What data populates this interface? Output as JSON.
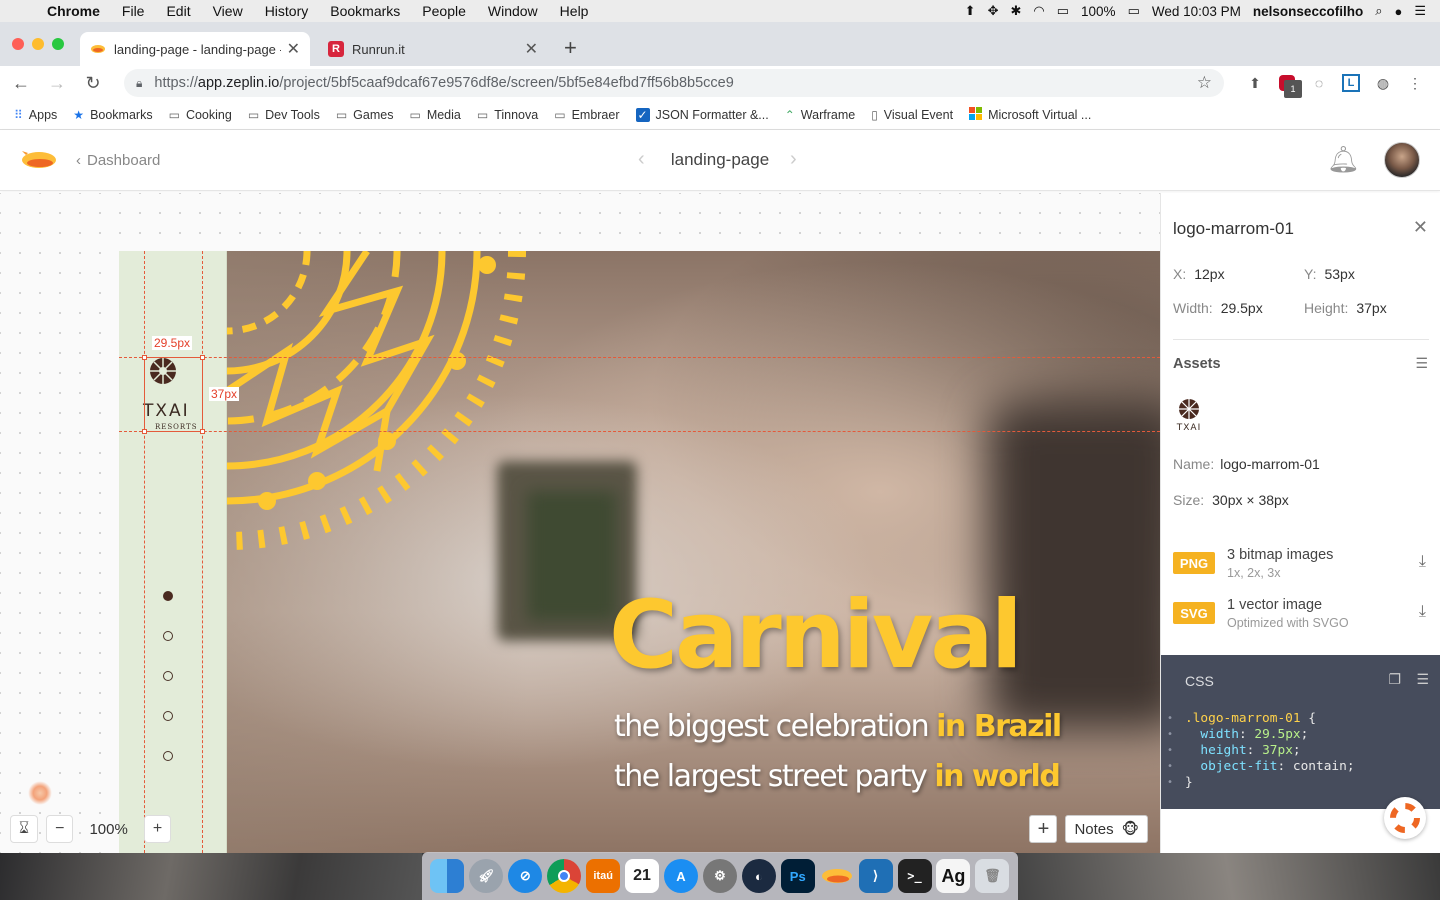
{
  "menubar": {
    "app": "Chrome",
    "items": [
      "File",
      "Edit",
      "View",
      "History",
      "Bookmarks",
      "People",
      "Window",
      "Help"
    ],
    "battery": "100%",
    "clock": "Wed 10:03 PM",
    "user": "nelsonseccofilho"
  },
  "tabs": [
    {
      "title": "landing-page - landing-page - ",
      "icon": "zeplin-favicon"
    },
    {
      "title": "Runrun.it",
      "icon": "runrun-favicon"
    }
  ],
  "address": {
    "scheme": "https://",
    "host": "app.zeplin.io",
    "path": "/project/5bf5caaf9dcaf67e9576df8e/screen/5bf5e84efbd7ff56b8b5cce9"
  },
  "extensions": {
    "abp_badge": "1"
  },
  "bookmarks": [
    {
      "label": "Apps",
      "icon": "apps-grid-icon"
    },
    {
      "label": "Bookmarks",
      "icon": "star-icon"
    },
    {
      "label": "Cooking",
      "icon": "folder-icon"
    },
    {
      "label": "Dev Tools",
      "icon": "folder-icon"
    },
    {
      "label": "Games",
      "icon": "folder-icon"
    },
    {
      "label": "Media",
      "icon": "folder-icon"
    },
    {
      "label": "Tinnova",
      "icon": "folder-icon"
    },
    {
      "label": "Embraer",
      "icon": "folder-icon"
    },
    {
      "label": "JSON Formatter &...",
      "icon": "checkbox-icon"
    },
    {
      "label": "Warframe",
      "icon": "warframe-icon"
    },
    {
      "label": "Visual Event",
      "icon": "page-icon"
    },
    {
      "label": "Microsoft Virtual ...",
      "icon": "microsoft-icon"
    }
  ],
  "zeplin": {
    "back_label": "Dashboard",
    "screen_title": "landing-page",
    "zoom": "100%",
    "notes_label": "Notes"
  },
  "artboard": {
    "headline": "Carnival",
    "line1_plain": "the biggest celebration ",
    "line1_bold": "in Brazil",
    "line2_plain": "the largest street party ",
    "line2_bold": "in world",
    "logo_text": "TXAI",
    "logo_sub": "RESORTS",
    "width_label": "29.5px",
    "height_label": "37px"
  },
  "panel": {
    "layer_name": "logo-marrom-01",
    "x_label": "X:",
    "x_value": "12px",
    "y_label": "Y:",
    "y_value": "53px",
    "w_label": "Width:",
    "w_value": "29.5px",
    "h_label": "Height:",
    "h_value": "37px",
    "assets_label": "Assets",
    "name_label": "Name:",
    "name_value": "logo-marrom-01",
    "size_label": "Size:",
    "size_value": "30px × 38px",
    "png": {
      "tag": "PNG",
      "title": "3 bitmap images",
      "sub": "1x, 2x, 3x"
    },
    "svg": {
      "tag": "SVG",
      "title": "1 vector image",
      "sub": "Optimized with SVGO"
    },
    "css_label": "CSS",
    "css": {
      "selector": ".logo-marrom-01",
      "width_prop": "width",
      "width_val": "29.5px",
      "height_prop": "height",
      "height_val": "37px",
      "fit_prop": "object-fit",
      "fit_val": "contain"
    }
  },
  "colors": {
    "accent_yellow": "#fdc82f",
    "measure_red": "#e45a3a",
    "css_panel_bg": "#464c5c",
    "asset_tag": "#f5b221"
  },
  "dock": [
    {
      "name": "finder-icon"
    },
    {
      "name": "launchpad-icon"
    },
    {
      "name": "safari-icon"
    },
    {
      "name": "chrome-icon"
    },
    {
      "name": "itau-icon",
      "label": "itaú"
    },
    {
      "name": "calendar-icon",
      "label": "21"
    },
    {
      "name": "app-store-icon"
    },
    {
      "name": "system-preferences-icon"
    },
    {
      "name": "sourcetree-icon"
    },
    {
      "name": "photoshop-icon",
      "label": "Ps"
    },
    {
      "name": "zeplin-icon"
    },
    {
      "name": "vscode-icon"
    },
    {
      "name": "terminal-icon"
    },
    {
      "name": "font-book-icon",
      "label": "Ag"
    },
    {
      "name": "trash-icon"
    }
  ]
}
